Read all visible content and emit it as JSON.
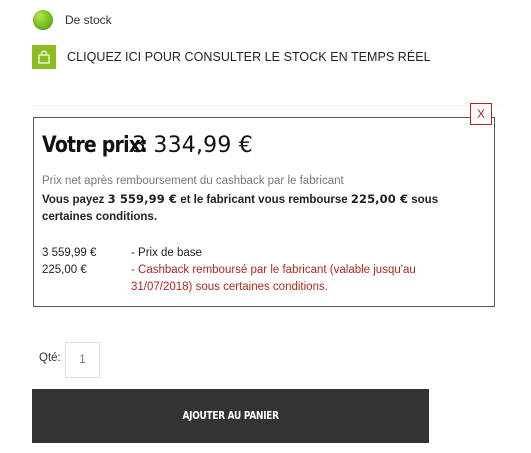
{
  "stock": {
    "status_label": "De stock",
    "status_color": "#7cc51f",
    "status_icon": "green-dot-icon"
  },
  "stock_link": {
    "icon": "shopping-bag-icon",
    "icon_bg_color": "#8cbd1e",
    "label": "CLIQUEZ ICI POUR CONSULTER LE STOCK EN TEMPS RÉEL"
  },
  "price_box": {
    "close_label": "X",
    "close_color": "#b3271a",
    "title_label": "Votre prix:",
    "title_value": "3 334,99 €",
    "net_note": "Prix net après remboursement du cashback par le fabricant",
    "pay": {
      "prefix": "Vous payez",
      "amount_paid": "3 559,99 €",
      "middle": "et le fabricant vous rembourse",
      "amount_refund": "225,00 €",
      "suffix": "sous certaines conditions."
    },
    "lines": [
      {
        "amount": "3 559,99 €",
        "description": "- Prix de base"
      },
      {
        "amount": "225,00 €",
        "description": "- Cashback remboursé par le fabricant (valable jusqu'au 31/07/2018) sous certaines conditions."
      }
    ],
    "cashback_color": "#b3271a"
  },
  "quantity": {
    "label": "Qté:",
    "placeholder": "1"
  },
  "cart": {
    "button_label": "AJOUTER AU PANIER",
    "button_color": "#333333"
  }
}
